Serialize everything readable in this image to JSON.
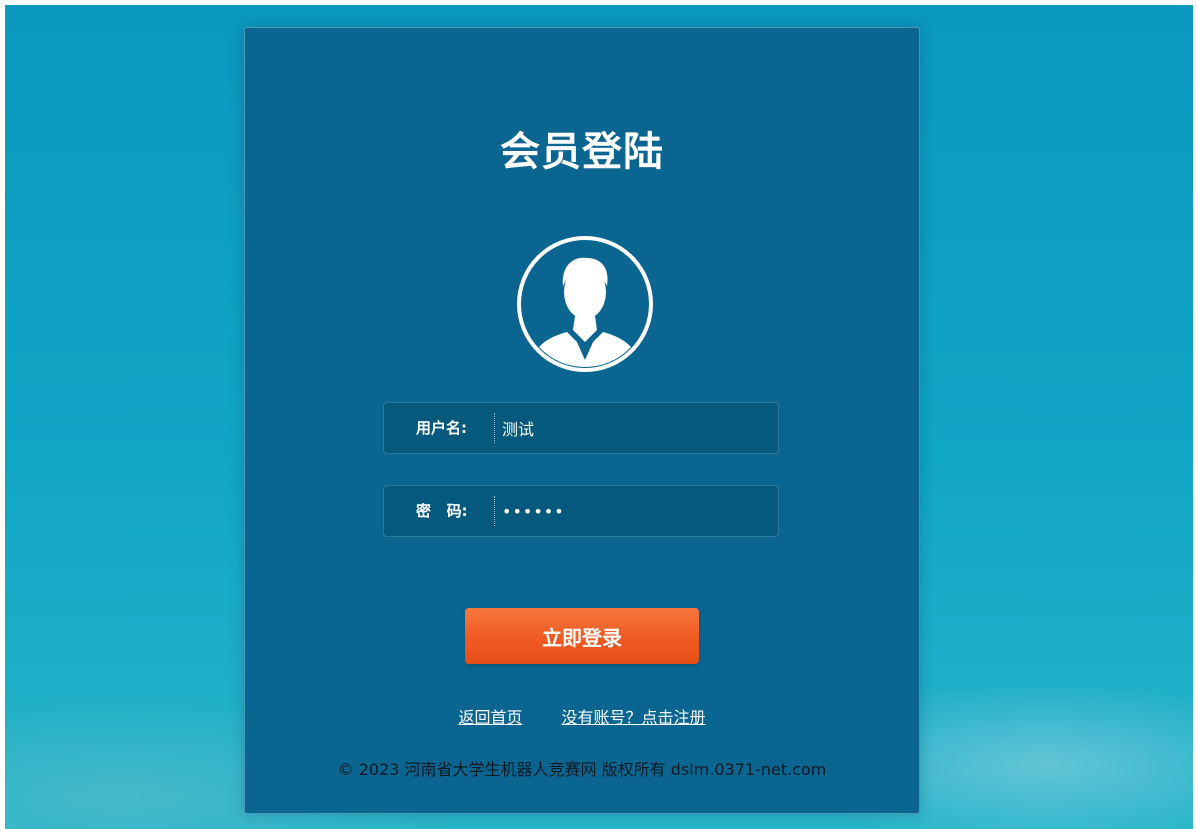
{
  "login": {
    "title": "会员登陆",
    "username_label": "用户名:",
    "username_value": "测试",
    "password_label": "密   码:",
    "password_value": "••••••",
    "submit_label": "立即登录",
    "back_home_link": "返回首页",
    "register_link": "没有账号？点击注册",
    "copyright": "© 2023 河南省大学生机器人竞赛网 版权所有 dslm.0371-net.com"
  },
  "colors": {
    "card_bg": "#0a6690",
    "field_bg": "#05597d",
    "button_orange": "#ef5a22",
    "page_bg": "#0a98be"
  },
  "icons": {
    "avatar": "user-avatar-icon"
  }
}
